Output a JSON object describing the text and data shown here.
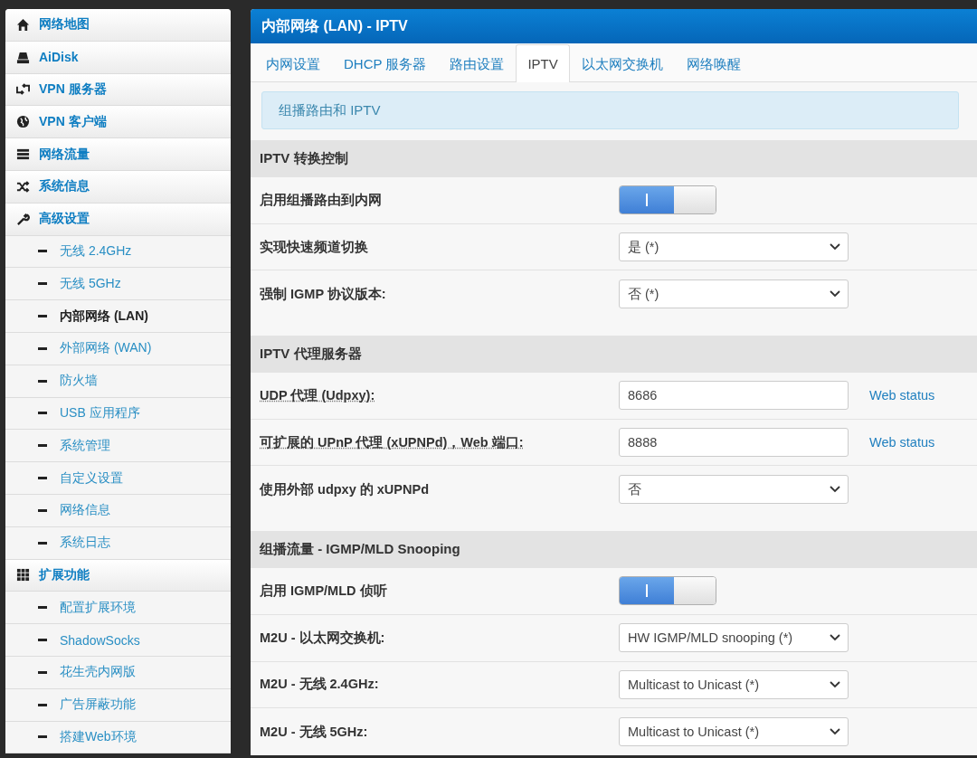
{
  "sidebar": {
    "items": [
      {
        "label": "网络地图",
        "kind": "main",
        "selected": false
      },
      {
        "label": "AiDisk",
        "kind": "main",
        "selected": false
      },
      {
        "label": "VPN 服务器",
        "kind": "main",
        "selected": false
      },
      {
        "label": "VPN 客户端",
        "kind": "main",
        "selected": false
      },
      {
        "label": "网络流量",
        "kind": "main",
        "selected": false
      },
      {
        "label": "系统信息",
        "kind": "main",
        "selected": false
      },
      {
        "label": "高级设置",
        "kind": "main",
        "selected": false
      },
      {
        "label": "无线 2.4GHz",
        "kind": "sub",
        "selected": false
      },
      {
        "label": "无线 5GHz",
        "kind": "sub",
        "selected": false
      },
      {
        "label": "内部网络 (LAN)",
        "kind": "sub",
        "selected": true
      },
      {
        "label": "外部网络 (WAN)",
        "kind": "sub",
        "selected": false
      },
      {
        "label": "防火墙",
        "kind": "sub",
        "selected": false
      },
      {
        "label": "USB 应用程序",
        "kind": "sub",
        "selected": false
      },
      {
        "label": "系统管理",
        "kind": "sub",
        "selected": false
      },
      {
        "label": "自定义设置",
        "kind": "sub",
        "selected": false
      },
      {
        "label": "网络信息",
        "kind": "sub",
        "selected": false
      },
      {
        "label": "系统日志",
        "kind": "sub",
        "selected": false
      },
      {
        "label": "扩展功能",
        "kind": "main",
        "selected": false
      },
      {
        "label": "配置扩展环境",
        "kind": "sub",
        "selected": false
      },
      {
        "label": "ShadowSocks",
        "kind": "sub",
        "selected": false
      },
      {
        "label": "花生壳内网版",
        "kind": "sub",
        "selected": false
      },
      {
        "label": "广告屏蔽功能",
        "kind": "sub",
        "selected": false
      },
      {
        "label": "搭建Web环境",
        "kind": "sub",
        "selected": false
      }
    ]
  },
  "panel": {
    "title": "内部网络 (LAN) - IPTV",
    "tabs": [
      {
        "label": "内网设置",
        "selected": false
      },
      {
        "label": "DHCP 服务器",
        "selected": false
      },
      {
        "label": "路由设置",
        "selected": false
      },
      {
        "label": "IPTV",
        "selected": true
      },
      {
        "label": "以太网交换机",
        "selected": false
      },
      {
        "label": "网络唤醒",
        "selected": false
      }
    ],
    "info_text": "组播路由和 IPTV",
    "sections": [
      {
        "title": "IPTV 转换控制",
        "rows": [
          {
            "label": "启用组播路由到内网",
            "kind": "toggle",
            "on": true
          },
          {
            "label": "实现快速频道切换",
            "kind": "select",
            "value": "是 (*)"
          },
          {
            "label": "强制 IGMP 协议版本:",
            "kind": "select",
            "value": "否 (*)"
          }
        ]
      },
      {
        "title": "IPTV 代理服务器",
        "rows": [
          {
            "label": "UDP 代理 (Udpxy):",
            "kind": "input",
            "value": "8686",
            "link": "Web status",
            "tooltip": true
          },
          {
            "label": "可扩展的 UPnP 代理 (xUPNPd)，Web 端口:",
            "kind": "input",
            "value": "8888",
            "link": "Web status",
            "tooltip": true
          },
          {
            "label": "使用外部 udpxy 的 xUPNPd",
            "kind": "select",
            "value": "否"
          }
        ]
      },
      {
        "title": "组播流量 - IGMP/MLD Snooping",
        "rows": [
          {
            "label": "启用 IGMP/MLD 侦听",
            "kind": "toggle",
            "on": true
          },
          {
            "label": "M2U - 以太网交换机:",
            "kind": "select",
            "value": "HW IGMP/MLD snooping (*)"
          },
          {
            "label": "M2U - 无线 2.4GHz:",
            "kind": "select",
            "value": "Multicast to Unicast (*)"
          },
          {
            "label": "M2U - 无线 5GHz:",
            "kind": "select",
            "value": "Multicast to Unicast (*)"
          }
        ]
      }
    ]
  }
}
